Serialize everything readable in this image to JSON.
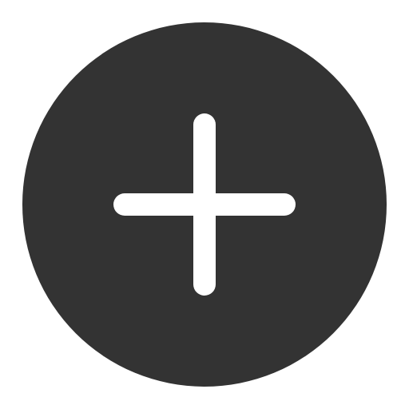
{
  "add_button": {
    "icon": "plus-icon",
    "background_color": "#333333",
    "icon_color": "#ffffff"
  }
}
